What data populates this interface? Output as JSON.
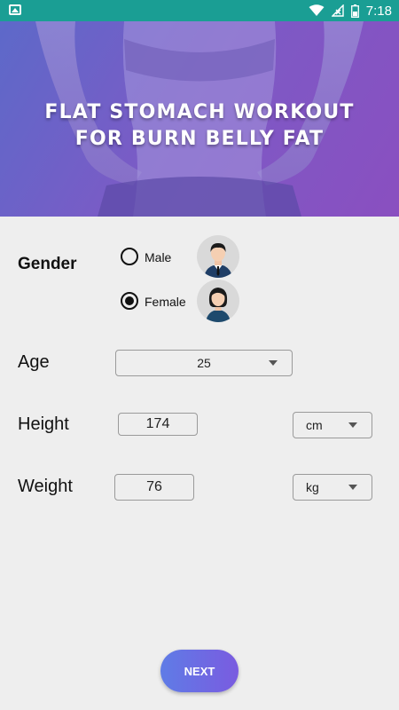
{
  "status_bar": {
    "time": "7:18",
    "icons": [
      "image-icon",
      "wifi-icon",
      "no-signal-icon",
      "battery-icon"
    ]
  },
  "hero": {
    "title_line1": "FLAT STOMACH WORKOUT",
    "title_line2": "FOR BURN BELLY FAT"
  },
  "form": {
    "gender": {
      "label": "Gender",
      "options": [
        {
          "label": "Male",
          "selected": false,
          "avatar": "male-avatar-icon"
        },
        {
          "label": "Female",
          "selected": true,
          "avatar": "female-avatar-icon"
        }
      ]
    },
    "age": {
      "label": "Age",
      "value": "25"
    },
    "height": {
      "label": "Height",
      "value": "174",
      "unit": "cm"
    },
    "weight": {
      "label": "Weight",
      "value": "76",
      "unit": "kg"
    }
  },
  "next_button": {
    "label": "NEXT"
  },
  "colors": {
    "status_bar": "#1a9e94",
    "button_start": "#5f7ce6",
    "button_end": "#7a5be0",
    "hero_overlay": "#7b5bc6"
  }
}
